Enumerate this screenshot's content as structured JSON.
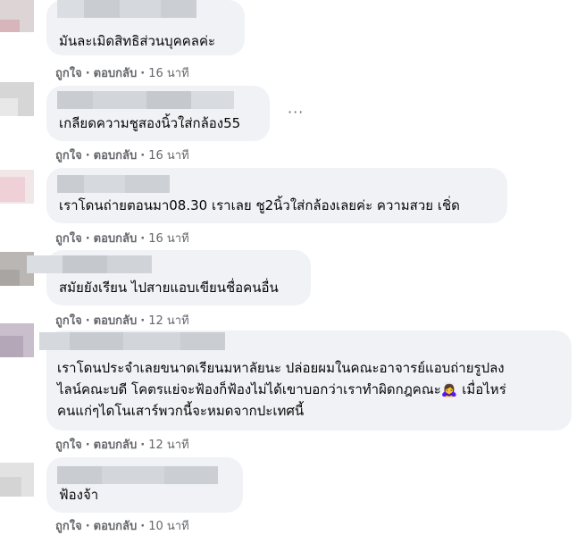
{
  "comments": [
    {
      "text": "มันละเมิดสิทธิส่วนบุคคลค่ะ",
      "actions": {
        "like": "ถูกใจ",
        "reply": "ตอบกลับ",
        "time": "16 นาที"
      }
    },
    {
      "text": "เกลียดความชูสองนิ้วใส่กล้อง55",
      "actions": {
        "like": "ถูกใจ",
        "reply": "ตอบกลับ",
        "time": "16 นาที"
      },
      "more_label": "···"
    },
    {
      "text": "เราโดนถ่ายตอนมา08.30 เราเลย ชู2นิ้วใส่กล้องเลยค่ะ ความสวย เชิ่ด",
      "actions": {
        "like": "ถูกใจ",
        "reply": "ตอบกลับ",
        "time": "16 นาที"
      }
    },
    {
      "text": "สมัยยังเรียน ไปสายแอบเขียนชื่อคนอื่น",
      "actions": {
        "like": "ถูกใจ",
        "reply": "ตอบกลับ",
        "time": "12 นาที"
      }
    },
    {
      "text": "เราโดนประจำเลยขนาดเรียนมหาลัยนะ ปล่อยผมในคณะอาจารย์แอบถ่ายรูปลง\nไลน์คณะบดี โคตรแย่จะฟ้องก็ฟ้องไม่ได้เขาบอกว่าเราทำผิดกฎคณะ🙇‍♀️ เมื่อไหร่\nคนแก่ๆไดโนเสาร์พวกนี้จะหมดจากปะเทศนี้",
      "actions": {
        "like": "ถูกใจ",
        "reply": "ตอบกลับ",
        "time": "12 นาที"
      }
    },
    {
      "text": "ฟ้องจ้า",
      "actions": {
        "like": "ถูกใจ",
        "reply": "ตอบกลับ",
        "time": "10 นาที"
      }
    }
  ],
  "colors": {
    "bubble": "#f0f2f5",
    "text": "#050505",
    "meta": "#65676b"
  }
}
